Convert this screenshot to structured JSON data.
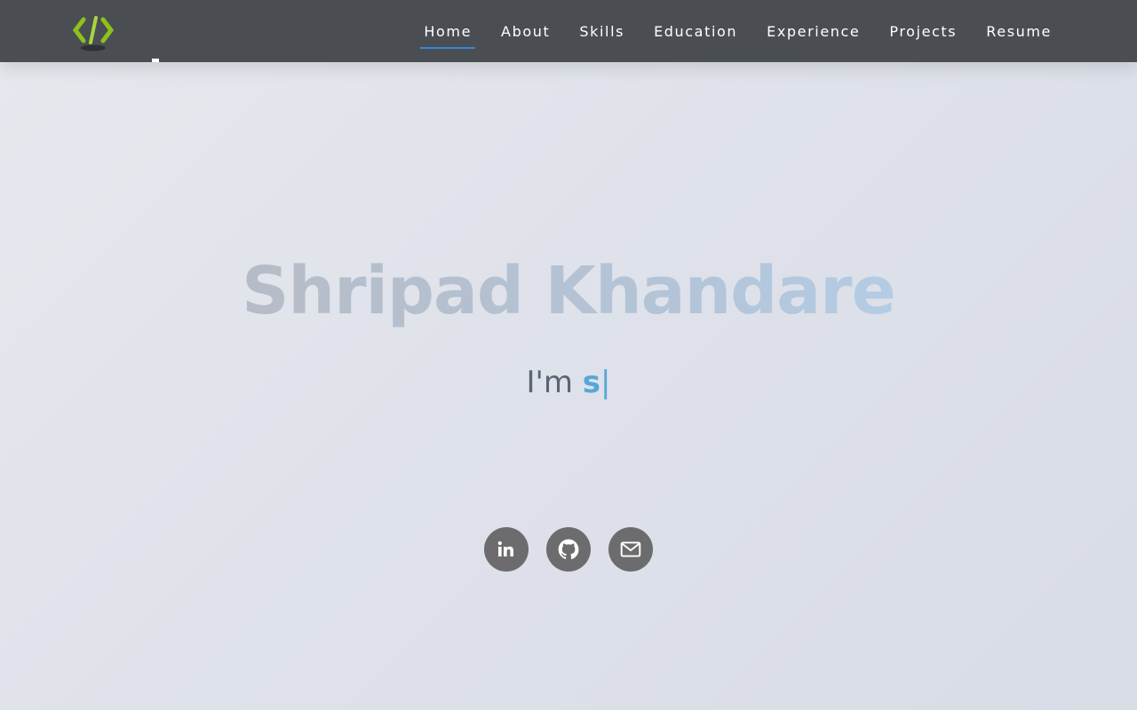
{
  "nav": {
    "logo_icon": "code-brackets-logo",
    "items": [
      {
        "label": "Home",
        "active": true
      },
      {
        "label": "About",
        "active": false
      },
      {
        "label": "Skills",
        "active": false
      },
      {
        "label": "Education",
        "active": false
      },
      {
        "label": "Experience",
        "active": false
      },
      {
        "label": "Projects",
        "active": false
      },
      {
        "label": "Resume",
        "active": false
      }
    ]
  },
  "hero": {
    "name": "Shripad Khandare",
    "intro": "I'm",
    "typed_text": "s",
    "cursor": "|"
  },
  "socials": [
    {
      "icon": "linkedin-icon"
    },
    {
      "icon": "github-icon"
    },
    {
      "icon": "mail-icon"
    }
  ],
  "colors": {
    "navbar": "#4a4e53",
    "accent": "#57a6dc",
    "active_underline": "#3a86d4",
    "logo_green": "#8cc21a",
    "social_bg": "#6c6c6e"
  }
}
